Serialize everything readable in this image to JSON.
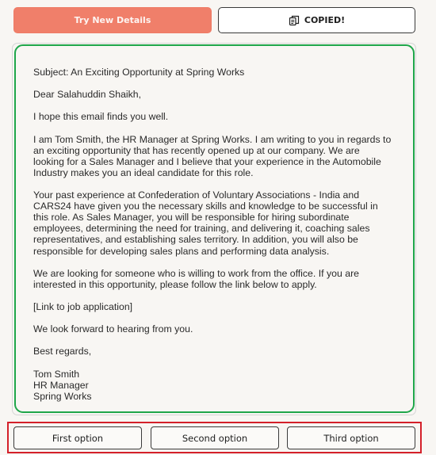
{
  "toolbar": {
    "try_label": "Try New Details",
    "copied_label": "COPIED!",
    "copied_icon": "copy-icon"
  },
  "email": {
    "subject": "Subject: An Exciting Opportunity at Spring Works",
    "greeting": "Dear Salahuddin Shaikh,",
    "intro": "I hope this email finds you well.",
    "para1_lines": [
      "I am Tom Smith, the HR Manager at Spring Works. I am writing to you in regards to",
      "an exciting opportunity that has recently opened up at our company. We are",
      "looking for a Sales Manager and I believe that your experience in the Automobile",
      "Industry makes you an ideal candidate for this role."
    ],
    "para2_lines": [
      "Your past experience at Confederation of Voluntary Associations - India and",
      "CARS24 have given you the necessary skills and knowledge to be successful in",
      "this role. As Sales Manager, you will be responsible for hiring subordinate",
      "employees, determining the need for training, and delivering it, coaching sales",
      "representatives, and establishing sales territory. In addition, you will also be",
      "responsible for developing sales plans and performing data analysis."
    ],
    "para3_lines": [
      "We are looking for someone who is willing to work from the office. If you are",
      "interested in this opportunity, please follow the link below to apply."
    ],
    "link_placeholder": "[Link to job application]",
    "closing_line": "We look forward to hearing from you.",
    "sign_off": "Best regards,",
    "signature": {
      "name": "Tom Smith",
      "title": "HR Manager",
      "company": "Spring Works"
    }
  },
  "options": [
    {
      "label": "First option"
    },
    {
      "label": "Second option"
    },
    {
      "label": "Third option"
    }
  ],
  "colors": {
    "background": "#f8f6f3",
    "try_button": "#f07f6a",
    "email_border": "#1fa64a",
    "options_border": "#d4202a"
  }
}
